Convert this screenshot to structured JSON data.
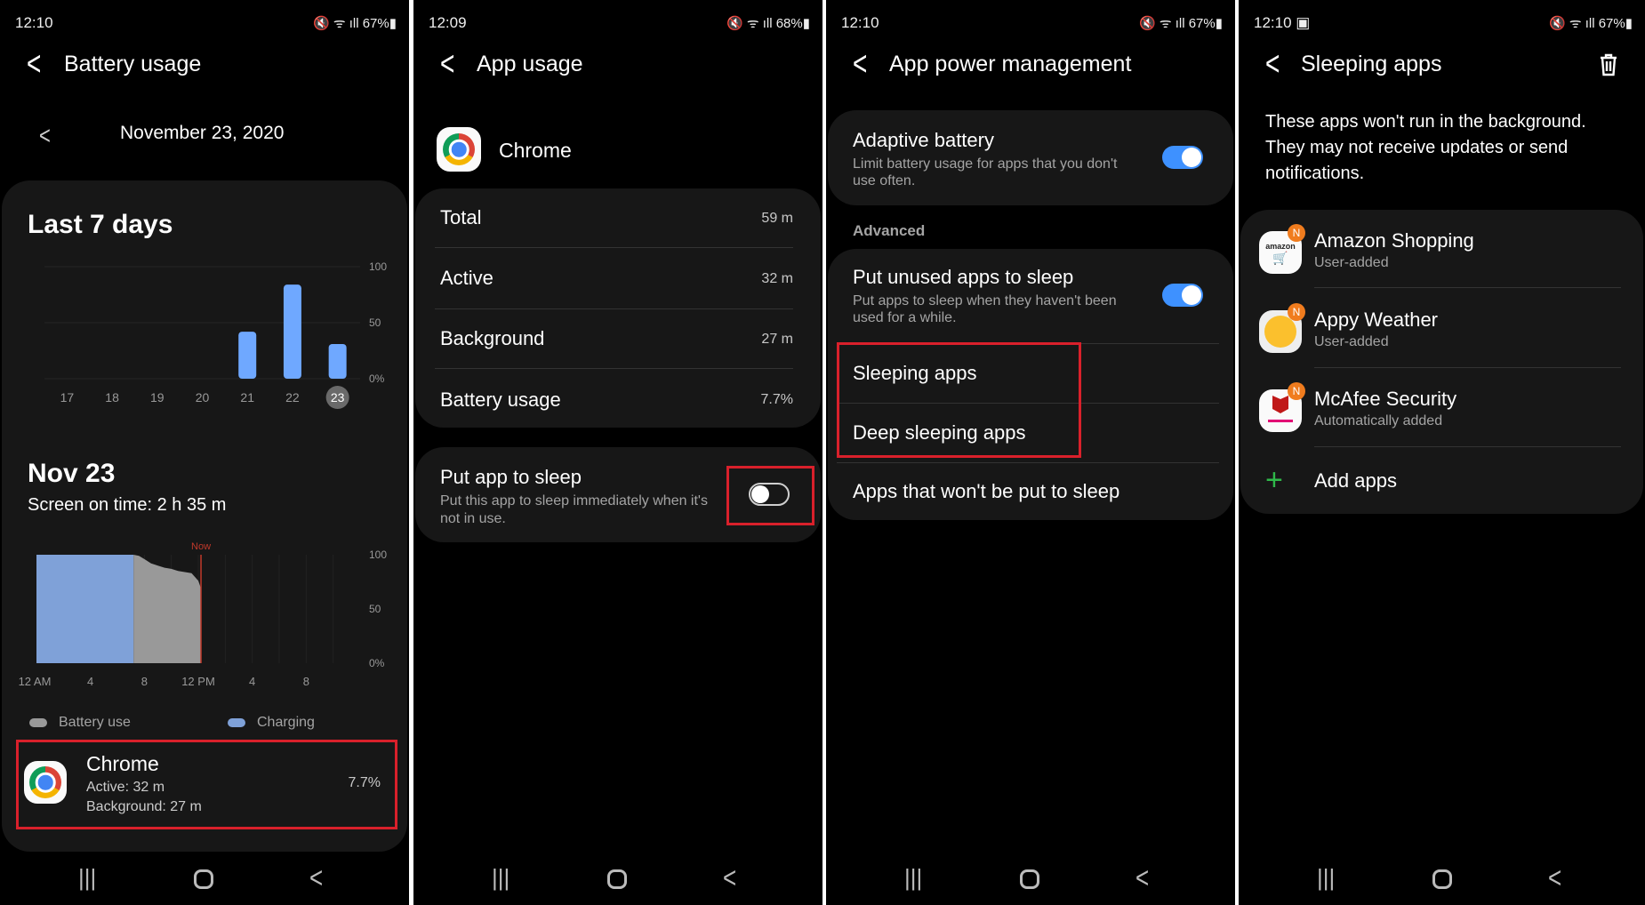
{
  "colors": {
    "accent": "#3e91ff",
    "bar": "#6fa8ff",
    "charging": "#7fa1d8",
    "battery_use": "#999999",
    "highlight": "#d9202b",
    "badge": "#f07c1e",
    "add": "#2fb84a"
  },
  "screens": [
    {
      "time": "12:10",
      "battery": "67%",
      "title": "Battery usage",
      "date": "November 23, 2020",
      "week_title": "Last 7 days",
      "week_chart": {
        "type": "bar",
        "categories": [
          "17",
          "18",
          "19",
          "20",
          "21",
          "22",
          "23"
        ],
        "values": [
          0,
          0,
          0,
          0,
          42,
          84,
          31
        ],
        "selected": "23",
        "ylim": [
          0,
          100
        ],
        "yticks": [
          "100",
          "50",
          "0%"
        ]
      },
      "day_title": "Nov 23",
      "screen_on": "Screen on time: 2 h 35 m",
      "day_chart": {
        "type": "area",
        "now_label": "Now",
        "now_hour": 12.2,
        "xticks": [
          "12 AM",
          "4",
          "8",
          "12 PM",
          "4",
          "8"
        ],
        "yticks": [
          "100",
          "50",
          "0%"
        ],
        "charging": [
          [
            0,
            100
          ],
          [
            7.2,
            100
          ]
        ],
        "battery_use": [
          [
            7.2,
            100
          ],
          [
            7.6,
            99
          ],
          [
            8,
            96
          ],
          [
            8.5,
            92
          ],
          [
            9,
            90
          ],
          [
            9.5,
            88
          ],
          [
            10,
            87
          ],
          [
            10.5,
            85
          ],
          [
            11,
            84
          ],
          [
            11.5,
            83
          ],
          [
            12,
            76
          ],
          [
            12.2,
            69
          ]
        ]
      },
      "legend": [
        "Battery use",
        "Charging"
      ],
      "app": {
        "name": "Chrome",
        "active": "Active: 32 m",
        "background": "Background: 27 m",
        "percent": "7.7%"
      }
    },
    {
      "time": "12:09",
      "battery": "68%",
      "title": "App usage",
      "app_name": "Chrome",
      "rows": [
        {
          "label": "Total",
          "value": "59 m"
        },
        {
          "label": "Active",
          "value": "32 m"
        },
        {
          "label": "Background",
          "value": "27 m"
        },
        {
          "label": "Battery usage",
          "value": "7.7%"
        }
      ],
      "sleep": {
        "label": "Put app to sleep",
        "desc1": "Put this app to sleep immediately when it's",
        "desc2": "not in use.",
        "enabled": false
      }
    },
    {
      "time": "12:10",
      "battery": "67%",
      "title": "App power management",
      "adaptive": {
        "label": "Adaptive battery",
        "desc1": "Limit battery usage for apps that you don't",
        "desc2": "use often.",
        "enabled": true
      },
      "advanced": "Advanced",
      "unused": {
        "label": "Put unused apps to sleep",
        "desc1": "Put apps to sleep when they haven't been",
        "desc2": "used for a while.",
        "enabled": true
      },
      "items": [
        "Sleeping apps",
        "Deep sleeping apps",
        "Apps that won't be put to sleep"
      ]
    },
    {
      "time": "12:10",
      "battery": "67%",
      "title": "Sleeping apps",
      "desc": [
        "These apps won't run in the background.",
        "They may not receive updates or send",
        "notifications."
      ],
      "apps": [
        {
          "name": "Amazon Shopping",
          "sub": "User-added",
          "badge": "N",
          "icon_text": "amazon"
        },
        {
          "name": "Appy Weather",
          "sub": "User-added",
          "badge": "N"
        },
        {
          "name": "McAfee Security",
          "sub": "Automatically added",
          "badge": "N"
        }
      ],
      "add": "Add apps"
    }
  ]
}
